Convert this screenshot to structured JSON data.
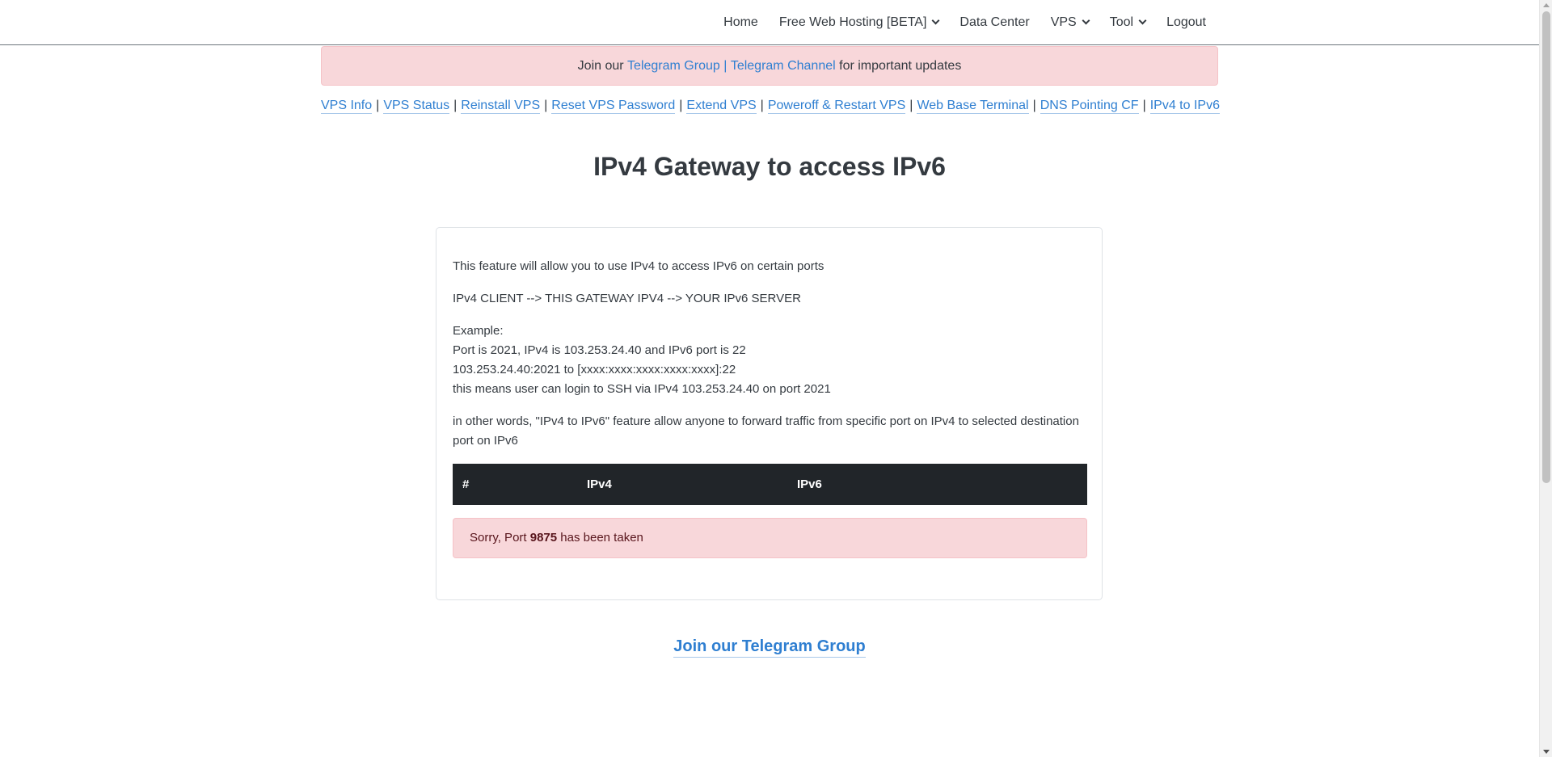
{
  "navbar": {
    "items": [
      {
        "label": "Home",
        "dropdown": false
      },
      {
        "label": "Free Web Hosting [BETA]",
        "dropdown": true
      },
      {
        "label": "Data Center",
        "dropdown": false
      },
      {
        "label": "VPS",
        "dropdown": true
      },
      {
        "label": "Tool",
        "dropdown": true
      },
      {
        "label": "Logout",
        "dropdown": false
      }
    ]
  },
  "announcement": {
    "prefix": "Join our ",
    "link1": "Telegram Group",
    "separator": " | ",
    "link2": "Telegram Channel",
    "suffix": " for important updates"
  },
  "subnav": {
    "items": [
      "VPS Info",
      "VPS Status",
      "Reinstall VPS",
      "Reset VPS Password",
      "Extend VPS",
      "Poweroff & Restart VPS",
      "Web Base Terminal",
      "DNS Pointing CF",
      "IPv4 to IPv6"
    ],
    "separator": "|"
  },
  "page": {
    "title": "IPv4 Gateway to access IPv6"
  },
  "card": {
    "intro": "This feature will allow you to use IPv4 to access IPv6 on certain ports",
    "flow": "IPv4 CLIENT --> THIS GATEWAY IPV4 --> YOUR IPv6 SERVER",
    "example_label": "Example:",
    "example_line1": "Port is 2021, IPv4 is 103.253.24.40 and IPv6 port is 22",
    "example_line2": "103.253.24.40:2021 to [xxxx:xxxx:xxxx:xxxx:xxxx]:22",
    "example_line3": "this means user can login to SSH via IPv4 103.253.24.40 on port 2021",
    "other_words": "in other words, \"IPv4 to IPv6\" feature allow anyone to forward traffic from specific port on IPv4 to selected destination port on IPv6",
    "table": {
      "headers": [
        "#",
        "IPv4",
        "IPv6"
      ]
    },
    "alert": {
      "prefix": "Sorry, Port ",
      "port": "9875",
      "suffix": " has been taken"
    }
  },
  "footer": {
    "telegram_link": "Join our Telegram Group"
  },
  "colors": {
    "link": "#2f7fd1",
    "alert_bg": "#f8d7da",
    "table_header_bg": "#212529"
  }
}
